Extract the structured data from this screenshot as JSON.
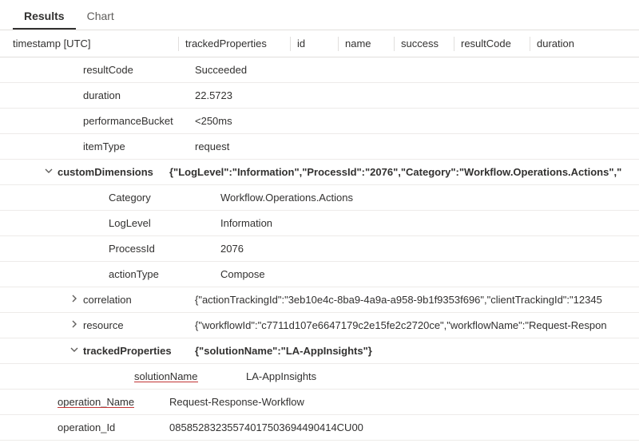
{
  "tabs": {
    "results": "Results",
    "chart": "Chart"
  },
  "headers": {
    "timestamp": "timestamp [UTC]",
    "trackedProperties": "trackedProperties",
    "id": "id",
    "name": "name",
    "success": "success",
    "resultCode": "resultCode",
    "duration": "duration"
  },
  "rows": {
    "resultCode": {
      "k": "resultCode",
      "v": "Succeeded"
    },
    "durationR": {
      "k": "duration",
      "v": "22.5723"
    },
    "perfBucket": {
      "k": "performanceBucket",
      "v": "<250ms"
    },
    "itemType": {
      "k": "itemType",
      "v": "request"
    },
    "customDimensions": {
      "k": "customDimensions",
      "v": "{\"LogLevel\":\"Information\",\"ProcessId\":\"2076\",\"Category\":\"Workflow.Operations.Actions\",\""
    },
    "category": {
      "k": "Category",
      "v": "Workflow.Operations.Actions"
    },
    "logLevel": {
      "k": "LogLevel",
      "v": "Information"
    },
    "processId": {
      "k": "ProcessId",
      "v": "2076"
    },
    "actionType": {
      "k": "actionType",
      "v": "Compose"
    },
    "correlation": {
      "k": "correlation",
      "v": "{\"actionTrackingId\":\"3eb10e4c-8ba9-4a9a-a958-9b1f9353f696\",\"clientTrackingId\":\"12345"
    },
    "resource": {
      "k": "resource",
      "v": "{\"workflowId\":\"c7711d107e6647179c2e15fe2c2720ce\",\"workflowName\":\"Request-Respon"
    },
    "tracked": {
      "k": "trackedProperties",
      "v": "{\"solutionName\":\"LA-AppInsights\"}"
    },
    "solutionName": {
      "k": "solutionName",
      "v": "LA-AppInsights"
    },
    "opName": {
      "k": "operation_Name",
      "v": "Request-Response-Workflow"
    },
    "opId": {
      "k": "operation_Id",
      "v": "08585283235574017503694490414CU00"
    }
  }
}
